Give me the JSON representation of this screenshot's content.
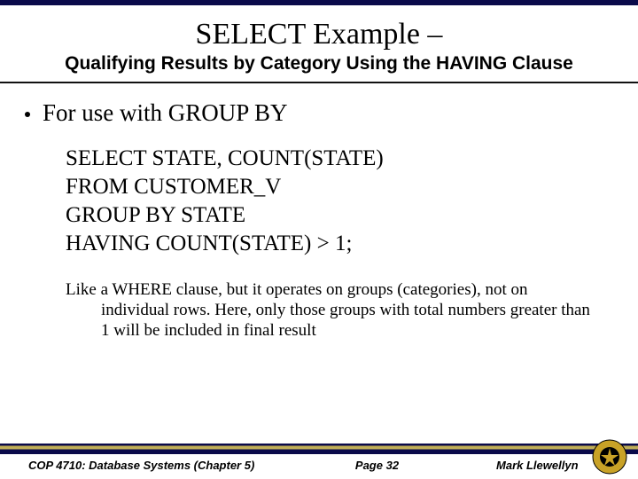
{
  "header": {
    "main_title": "SELECT Example –",
    "subtitle": "Qualifying Results by Category Using the HAVING Clause"
  },
  "body": {
    "bullet": "For use with GROUP BY",
    "code_lines": [
      "SELECT STATE, COUNT(STATE)",
      "FROM CUSTOMER_V",
      "GROUP BY STATE",
      "HAVING COUNT(STATE) > 1;"
    ],
    "explanation": "Like a WHERE clause, but it operates on groups (categories), not on individual rows. Here, only those groups with total numbers greater than 1 will be included in final result"
  },
  "footer": {
    "course": "COP 4710: Database Systems  (Chapter 5)",
    "page": "Page 32",
    "author": "Mark Llewellyn"
  }
}
